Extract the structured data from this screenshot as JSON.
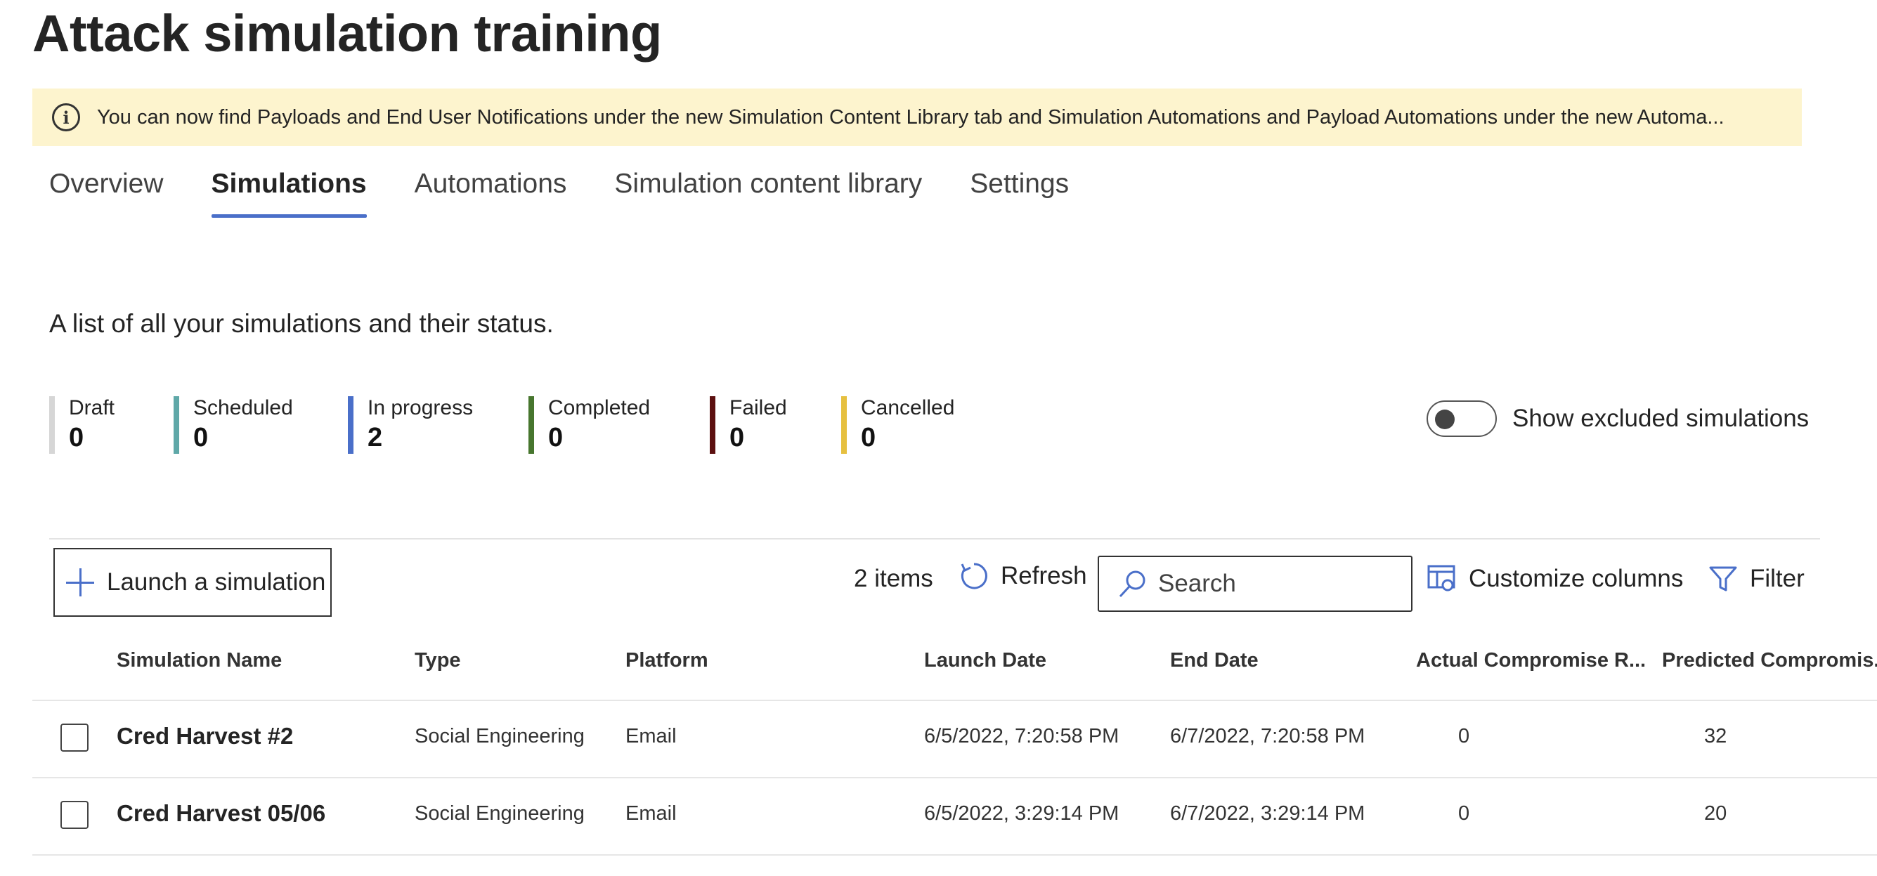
{
  "page": {
    "title": "Attack simulation training"
  },
  "banner": {
    "icon": "info-icon",
    "text": "You can now find Payloads and End User Notifications under the new Simulation Content Library tab and Simulation Automations and Payload Automations under the new Automa..."
  },
  "tabs": [
    {
      "label": "Overview"
    },
    {
      "label": "Simulations",
      "active": true
    },
    {
      "label": "Automations"
    },
    {
      "label": "Simulation content library"
    },
    {
      "label": "Settings"
    }
  ],
  "description": "A list of all your simulations and their status.",
  "status": [
    {
      "label": "Draft",
      "value": "0",
      "color": "#d6d6d6"
    },
    {
      "label": "Scheduled",
      "value": "0",
      "color": "#5fa8a8"
    },
    {
      "label": "In progress",
      "value": "2",
      "color": "#4a6fc9"
    },
    {
      "label": "Completed",
      "value": "0",
      "color": "#47762e"
    },
    {
      "label": "Failed",
      "value": "0",
      "color": "#5c1010"
    },
    {
      "label": "Cancelled",
      "value": "0",
      "color": "#e6c040"
    }
  ],
  "toggle": {
    "label": "Show excluded simulations",
    "on": false
  },
  "toolbar": {
    "launch_label": "Launch a simulation",
    "items_count": "2 items",
    "refresh_label": "Refresh",
    "search_placeholder": "Search",
    "customize_label": "Customize columns",
    "filter_label": "Filter"
  },
  "table": {
    "columns": [
      "Simulation Name",
      "Type",
      "Platform",
      "Launch Date",
      "End Date",
      "Actual Compromise R...",
      "Predicted Compromis..."
    ],
    "rows": [
      {
        "name": "Cred Harvest #2",
        "type": "Social Engineering",
        "platform": "Email",
        "launch": "6/5/2022, 7:20:58 PM",
        "end": "6/7/2022, 7:20:58 PM",
        "actual": "0",
        "predicted": "32"
      },
      {
        "name": "Cred Harvest 05/06",
        "type": "Social Engineering",
        "platform": "Email",
        "launch": "6/5/2022, 3:29:14 PM",
        "end": "6/7/2022, 3:29:14 PM",
        "actual": "0",
        "predicted": "20"
      }
    ]
  }
}
